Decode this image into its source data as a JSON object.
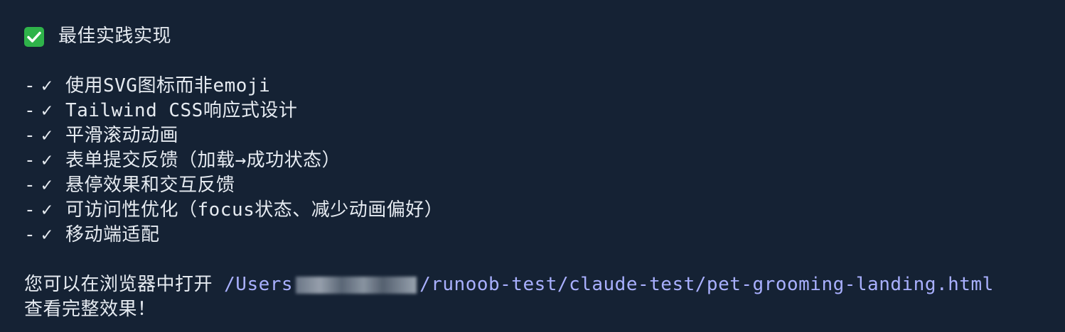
{
  "heading": {
    "icon": "check-box-icon",
    "text": "最佳实践实现"
  },
  "list_items": [
    {
      "dash": "-",
      "check": "✓",
      "text": "使用SVG图标而非emoji"
    },
    {
      "dash": "-",
      "check": "✓",
      "text": "Tailwind CSS响应式设计"
    },
    {
      "dash": "-",
      "check": "✓",
      "text": "平滑滚动动画"
    },
    {
      "dash": "-",
      "check": "✓",
      "text": "表单提交反馈（加载→成功状态）"
    },
    {
      "dash": "-",
      "check": "✓",
      "text": "悬停效果和交互反馈"
    },
    {
      "dash": "-",
      "check": "✓",
      "text": "可访问性优化（focus状态、减少动画偏好）"
    },
    {
      "dash": "-",
      "check": "✓",
      "text": "移动端适配"
    }
  ],
  "footer": {
    "before_path": "您可以在浏览器中打开 ",
    "path_prefix": "/Users",
    "path_suffix": "/runoob-test/claude-test/pet-grooming-landing.html",
    "line2": "查看完整效果！"
  },
  "colors": {
    "background": "#152234",
    "text": "#e6ebf1",
    "path": "#a9b0ff",
    "check_box": "#2fb34a"
  }
}
